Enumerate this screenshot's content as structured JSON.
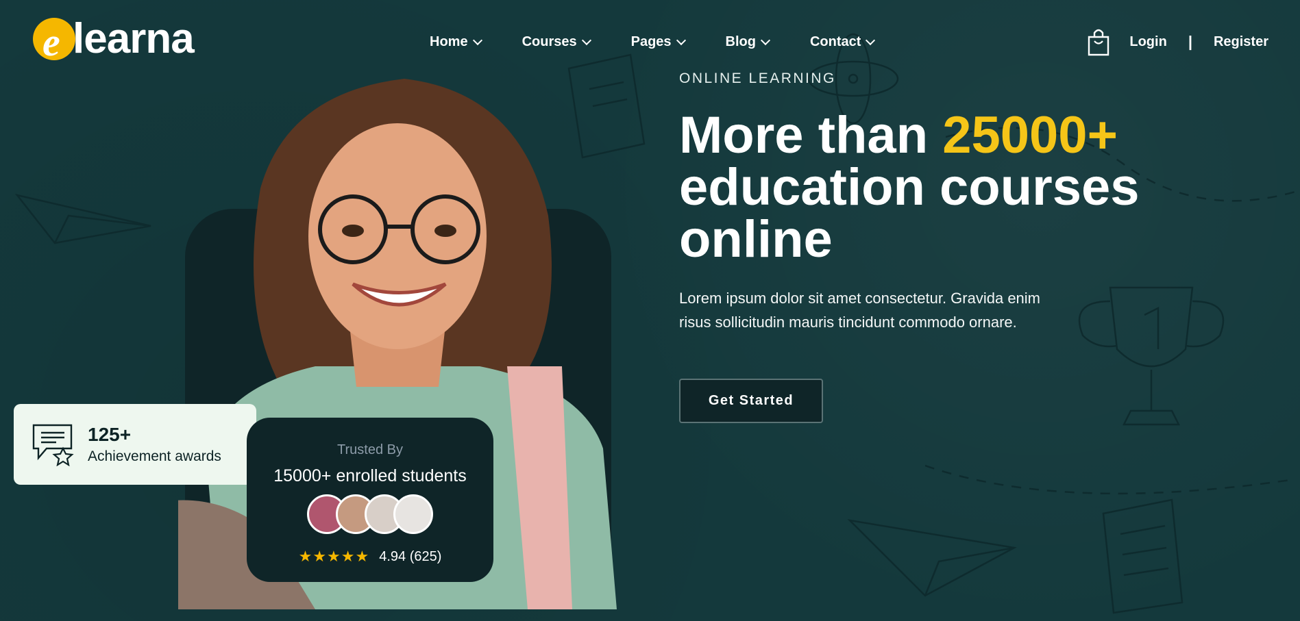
{
  "brand": {
    "logo_initial": "e",
    "logo_text": "learna",
    "accent": "#f5c518"
  },
  "nav": {
    "items": [
      {
        "label": "Home"
      },
      {
        "label": "Courses"
      },
      {
        "label": "Pages"
      },
      {
        "label": "Blog"
      },
      {
        "label": "Contact"
      }
    ]
  },
  "header": {
    "cart_icon": "shopping-bag-icon",
    "login_label": "Login",
    "separator": "|",
    "register_label": "Register"
  },
  "hero": {
    "eyebrow": "ONLINE LEARNING",
    "headline_prefix": "More than ",
    "headline_accent": "25000+",
    "headline_suffix": "education courses online",
    "lead": "Lorem ipsum dolor sit amet consectetur. Gravida enim risus sollicitudin mauris tincidunt commodo ornare.",
    "cta_label": "Get Started"
  },
  "awards": {
    "count": "125+",
    "label": "Achievement awards",
    "icon": "award-chat-star-icon"
  },
  "trust": {
    "title": "Trusted By",
    "subtitle": "15000+ enrolled students",
    "stars": "★★★★★",
    "rating_value": 4.94,
    "rating": "4.94 (625)",
    "avatars": [
      {
        "color": "#b0566e"
      },
      {
        "color": "#c59a80"
      },
      {
        "color": "#d8cfc8"
      },
      {
        "color": "#e7e4e1"
      }
    ]
  },
  "colors": {
    "background": "#14393c",
    "card_dark": "#0f2528",
    "award_card": "#eef7ef",
    "star": "#f5b700"
  }
}
